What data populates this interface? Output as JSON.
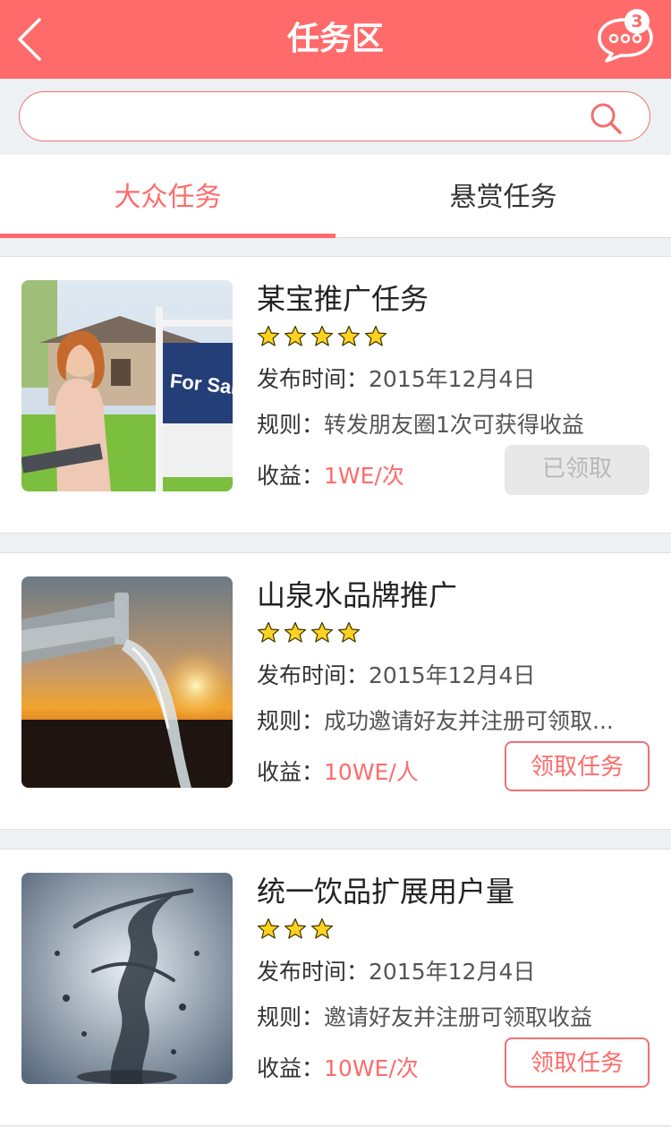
{
  "header": {
    "title": "任务区",
    "message_count": "3"
  },
  "search": {
    "placeholder": ""
  },
  "tabs": [
    {
      "label": "大众任务",
      "active": true
    },
    {
      "label": "悬赏任务",
      "active": false
    }
  ],
  "labels": {
    "publish_time": "发布时间：",
    "rule": "规则：",
    "income": "收益："
  },
  "tasks": [
    {
      "title": "某宝推广任务",
      "rating": 5,
      "publish_time": "2015年12月4日",
      "rule": "转发朋友圈1次可获得收益",
      "income": "1WE/次",
      "button": "已领取",
      "sign_text": "For Sale"
    },
    {
      "title": "山泉水品牌推广",
      "rating": 4,
      "publish_time": "2015年12月4日",
      "rule": "成功邀请好友并注册可领取...",
      "income": "10WE/人",
      "button": "领取任务"
    },
    {
      "title": "统一饮品扩展用户量",
      "rating": 3,
      "publish_time": "2015年12月4日",
      "rule": "邀请好友并注册可领取收益",
      "income": "10WE/次",
      "button": "领取任务"
    }
  ],
  "colors": {
    "accent": "#ff6b6b",
    "star": "#ffd21f"
  }
}
